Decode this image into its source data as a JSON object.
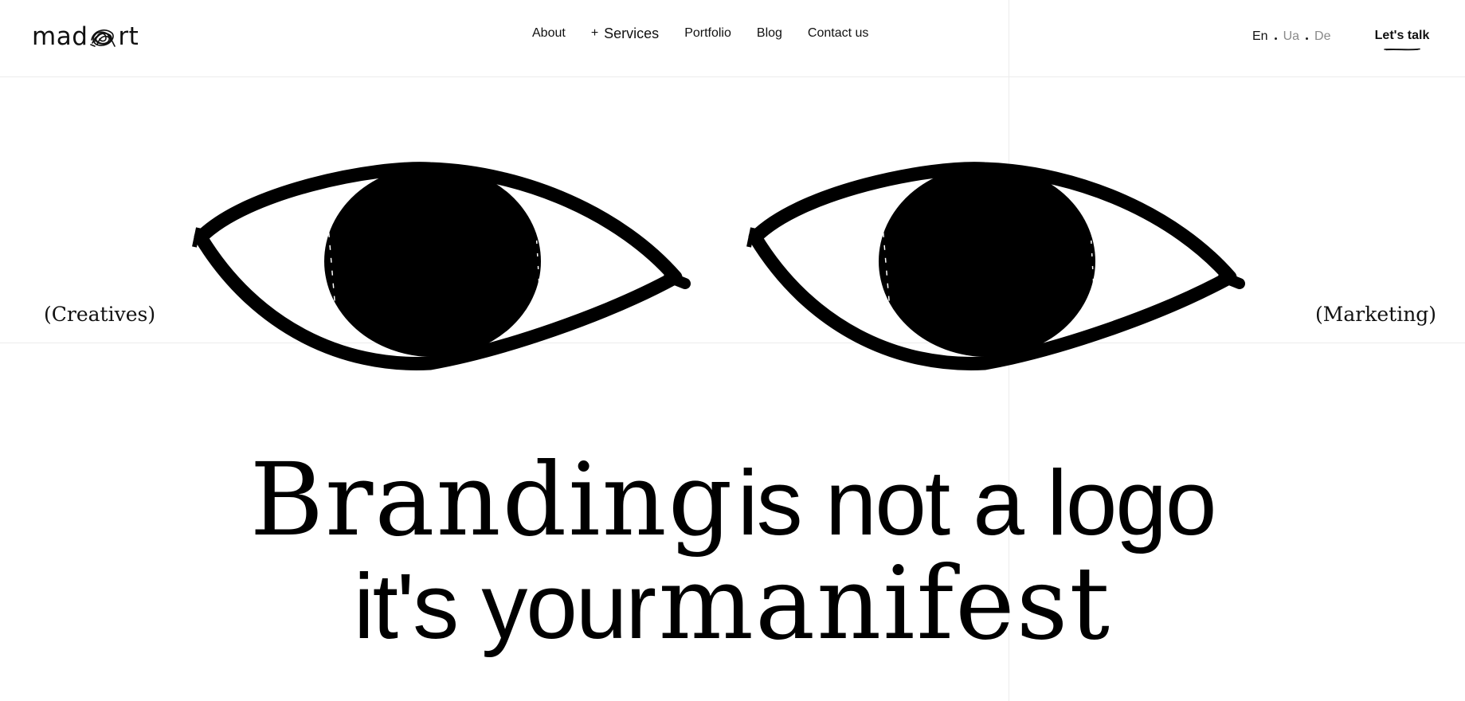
{
  "header": {
    "logo": {
      "text_before": "mad",
      "text_after": "rt",
      "icon": "scribble-a-icon"
    },
    "nav": {
      "about": "About",
      "services_prefix": "+",
      "services": "Services",
      "portfolio": "Portfolio",
      "blog": "Blog",
      "contact": "Contact us"
    },
    "languages": [
      {
        "label": "En",
        "active": true
      },
      {
        "label": "Ua",
        "active": false
      },
      {
        "label": "De",
        "active": false
      }
    ],
    "cta": "Let's talk"
  },
  "hero": {
    "left_label": "(Creatives)",
    "right_label": "(Marketing)",
    "illustration": "eyes-illustration",
    "headline": {
      "line1_serif": "Branding",
      "line1_sans": "is not a logo",
      "line2_sans": "it's your",
      "line2_serif": "manifest"
    }
  },
  "colors": {
    "text": "#111111",
    "background": "#ffffff",
    "grid_line": "#ececec",
    "inactive_lang": "#8a8a8a"
  }
}
